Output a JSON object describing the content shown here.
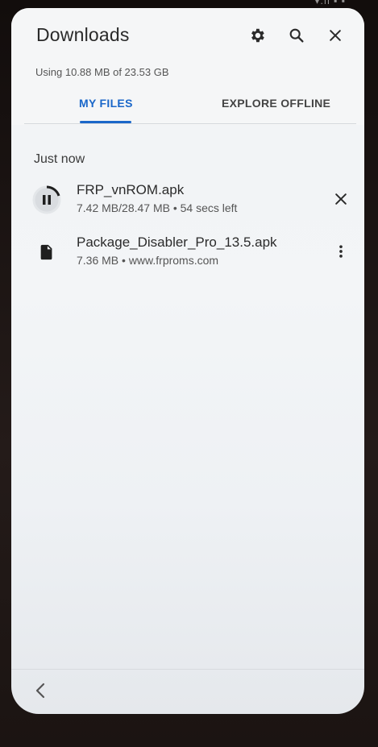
{
  "app": {
    "title": "Downloads",
    "storage_text": "Using 10.88 MB of 23.53 GB"
  },
  "toolbar": {
    "settings_icon": "gear-icon",
    "search_icon": "search-icon",
    "close_icon": "close-icon"
  },
  "tabs": [
    {
      "label": "MY FILES",
      "active": true
    },
    {
      "label": "EXPLORE OFFLINE",
      "active": false
    }
  ],
  "section": {
    "header": "Just now"
  },
  "downloads": [
    {
      "name": "FRP_vnROM.apk",
      "meta": "7.42 MB/28.47 MB • 54 secs left",
      "status": "downloading",
      "progress": 0.26,
      "leading_icon": "pause-icon",
      "trailing_icon": "close-icon"
    },
    {
      "name": "Package_Disabler_Pro_13.5.apk",
      "meta": "7.36 MB • www.frproms.com",
      "status": "complete",
      "leading_icon": "file-icon",
      "trailing_icon": "more-vert-icon"
    }
  ],
  "nav": {
    "back_icon": "back-arrow-icon"
  },
  "colors": {
    "accent": "#1a67c9",
    "background": "#f2f4f6",
    "text": "#2b2b2b"
  }
}
